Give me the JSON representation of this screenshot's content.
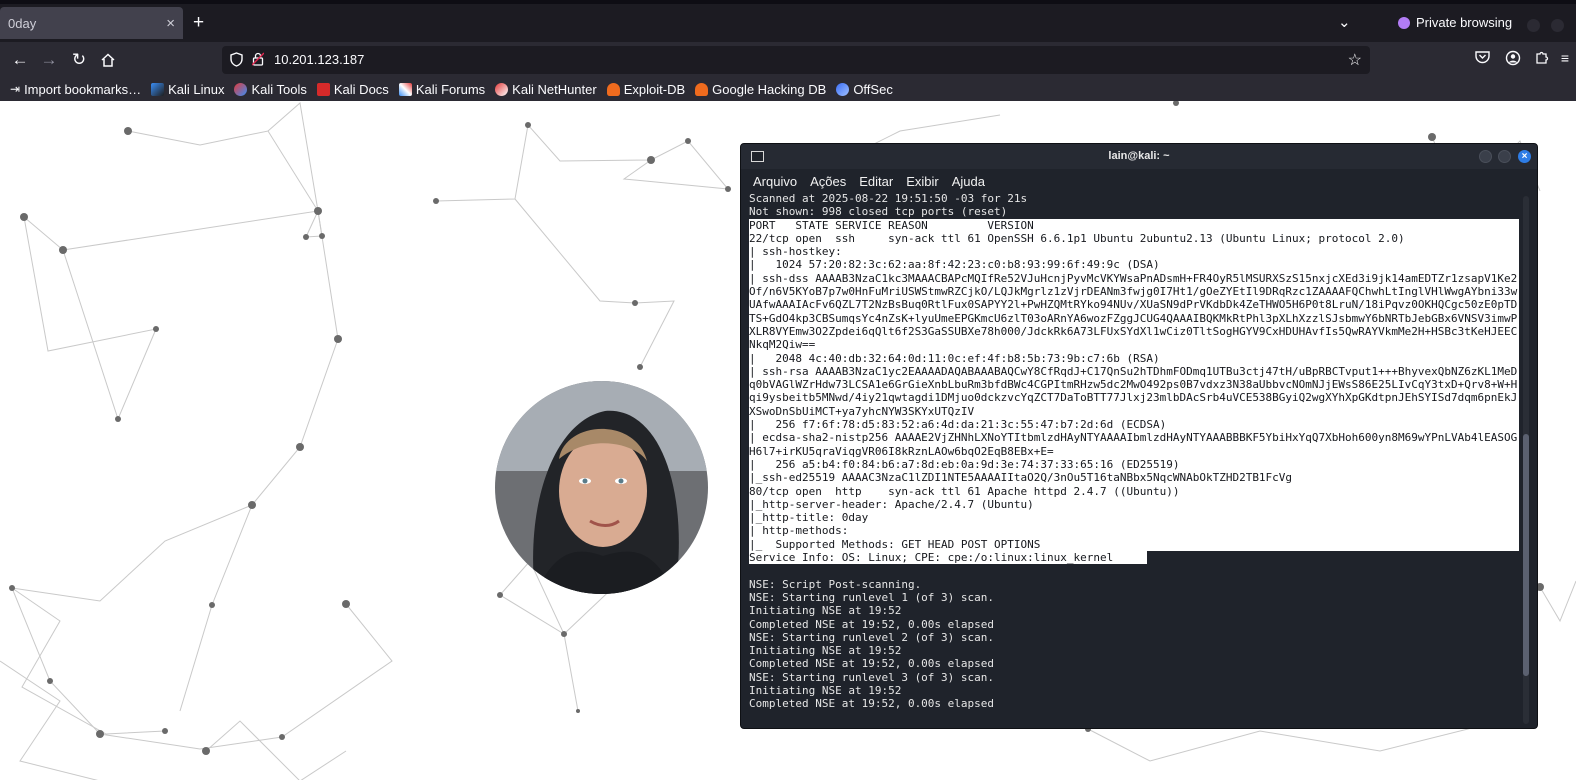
{
  "browser": {
    "tab": {
      "title": "0day",
      "close_glyph": "×"
    },
    "new_tab_glyph": "+",
    "list_tabs_glyph": "⌄",
    "private_label": "Private browsing",
    "url": "10.201.123.187",
    "bookmarks": [
      {
        "label": "Import bookmarks…",
        "icon": "import-icon",
        "color": "#fbfbfe"
      },
      {
        "label": "Kali Linux",
        "icon": "kali-dragon-icon",
        "color": "#3a8ef6"
      },
      {
        "label": "Kali Tools",
        "icon": "kali-tools-icon",
        "color": "#e23a3a"
      },
      {
        "label": "Kali Docs",
        "icon": "kali-docs-icon",
        "color": "#d62a2a"
      },
      {
        "label": "Kali Forums",
        "icon": "kali-forums-icon",
        "color": "#3a8ef6"
      },
      {
        "label": "Kali NetHunter",
        "icon": "nethunter-icon",
        "color": "#e23a3a"
      },
      {
        "label": "Exploit-DB",
        "icon": "exploit-db-icon",
        "color": "#ef6b1e"
      },
      {
        "label": "Google Hacking DB",
        "icon": "ghdb-icon",
        "color": "#ef6b1e"
      },
      {
        "label": "OffSec",
        "icon": "offsec-icon",
        "color": "#3a6ef6"
      }
    ]
  },
  "terminal": {
    "title": "lain@kali: ~",
    "menu": [
      "Arquivo",
      "Ações",
      "Editar",
      "Exibir",
      "Ajuda"
    ],
    "lines_pre": [
      "Scanned at 2025-08-22 19:51:50 -03 for 21s",
      "Not shown: 998 closed tcp ports (reset)"
    ],
    "lines_selected": [
      "PORT   STATE SERVICE REASON         VERSION",
      "22/tcp open  ssh     syn-ack ttl 61 OpenSSH 6.6.1p1 Ubuntu 2ubuntu2.13 (Ubuntu Linux; protocol 2.0)",
      "| ssh-hostkey:",
      "|   1024 57:20:82:3c:62:aa:8f:42:23:c0:b8:93:99:6f:49:9c (DSA)",
      "| ssh-dss AAAAB3NzaC1kc3MAAACBAPcMQIfRe52VJuHcnjPyvMcVKYWsaPnADsmH+FR4OyR5lMSURXSzS15nxjcXEd3i9jk14amEDTZr1zsapV1Ke2",
      "Of/n6V5KYoB7p7w0HnFuMriUSWStmwRZCjkO/LQJkMgrlz1zVjrDEANm3fwjg0I7Ht1/gOeZYEtIl9DRqRzc1ZAAAAFQChwhLtInglVHlWwgAYbni33w",
      "UAfwAAAIAcFv6QZL7T2NzBsBuq0RtlFux0SAPYY2l+PwHZQMtRYko94NUv/XUaSN9dPrVKdbDk4ZeTHWO5H6P0t8LruN/18iPqvz0OKHQCgc50zE0pTD",
      "TS+GdO4kp3CBSumqsYc4nZsK+lyuUmeEPGKmcU6zlT03oARnYA6wozFZggJCUG4QAAAIBQKMkRtPhl3pXLhXzzlSJsbmwY6bNRTbJebGBx6VNSV3imwP",
      "XLR8VYEmw3O2Zpdei6qQlt6f2S3GaSSUBXe78h000/JdckRk6A73LFUxSYdXl1wCiz0TltSogHGYV9CxHDUHAvfIs5QwRAYVkmMe2H+HSBc3tKeHJEEC",
      "NkqM2Qiw==",
      "|   2048 4c:40:db:32:64:0d:11:0c:ef:4f:b8:5b:73:9b:c7:6b (RSA)",
      "| ssh-rsa AAAAB3NzaC1yc2EAAAADAQABAAABAQCwY8CfRqdJ+C17QnSu2hTDhmFODmq1UTBu3ctj47tH/uBpRBCTvput1+++BhyvexQbNZ6zKL1MeD",
      "q0bVAGlWZrHdw73LCSA1e6GrGieXnbLbuRm3bfdBWc4CGPItmRHzw5dc2MwO492ps0B7vdxz3N38aUbbvcNOmNJjEWsS86E25LIvCqY3txD+Qrv8+W+H",
      "qi9ysbeitb5MNwd/4iy21qwtagdi1DMjuo0dckzvcYqZCT7DaToBTT77Jlxj23mlbDAcSrb4uVCE538BGyiQ2wgXYhXpGKdtpnJEhSYISd7dqm6pnEkJ",
      "XSwoDnSbUiMCT+ya7yhcNYW3SKYxUTQzIV",
      "|   256 f7:6f:78:d5:83:52:a6:4d:da:21:3c:55:47:b7:2d:6d (ECDSA)",
      "| ecdsa-sha2-nistp256 AAAAE2VjZHNhLXNoYTItbmlzdHAyNTYAAAAIbmlzdHAyNTYAAABBBKF5YbiHxYqQ7XbHoh600yn8M69wYPnLVAb4lEASOG",
      "H6l7+irKU5qraViqgVR06I8kRznLAOw6bqO2EqB8EBx+E=",
      "|   256 a5:b4:f0:84:b6:a7:8d:eb:0a:9d:3e:74:37:33:65:16 (ED25519)",
      "|_ssh-ed25519 AAAAC3NzaC1lZDI1NTE5AAAAIItaO2Q/3nOu5T16taNBbx5NqcWNAbOkTZHD2TB1FcVg",
      "80/tcp open  http    syn-ack ttl 61 Apache httpd 2.4.7 ((Ubuntu))",
      "|_http-server-header: Apache/2.4.7 (Ubuntu)",
      "|_http-title: 0day",
      "| http-methods:",
      "|_  Supported Methods: GET HEAD POST OPTIONS"
    ],
    "line_selected_last": "Service Info: OS: Linux; CPE: cpe:/o:linux:linux_kernel",
    "lines_post": [
      "",
      "NSE: Script Post-scanning.",
      "NSE: Starting runlevel 1 (of 3) scan.",
      "Initiating NSE at 19:52",
      "Completed NSE at 19:52, 0.00s elapsed",
      "NSE: Starting runlevel 2 (of 3) scan.",
      "Initiating NSE at 19:52",
      "Completed NSE at 19:52, 0.00s elapsed",
      "NSE: Starting runlevel 3 (of 3) scan.",
      "Initiating NSE at 19:52",
      "Completed NSE at 19:52, 0.00s elapsed"
    ]
  },
  "colors": {
    "chrome_dark": "#1c1b22",
    "chrome_toolbar": "#2b2a33",
    "terminal_bg": "#1f232b",
    "terminal_close": "#2e7de6",
    "private_accent": "#b27cf5"
  }
}
